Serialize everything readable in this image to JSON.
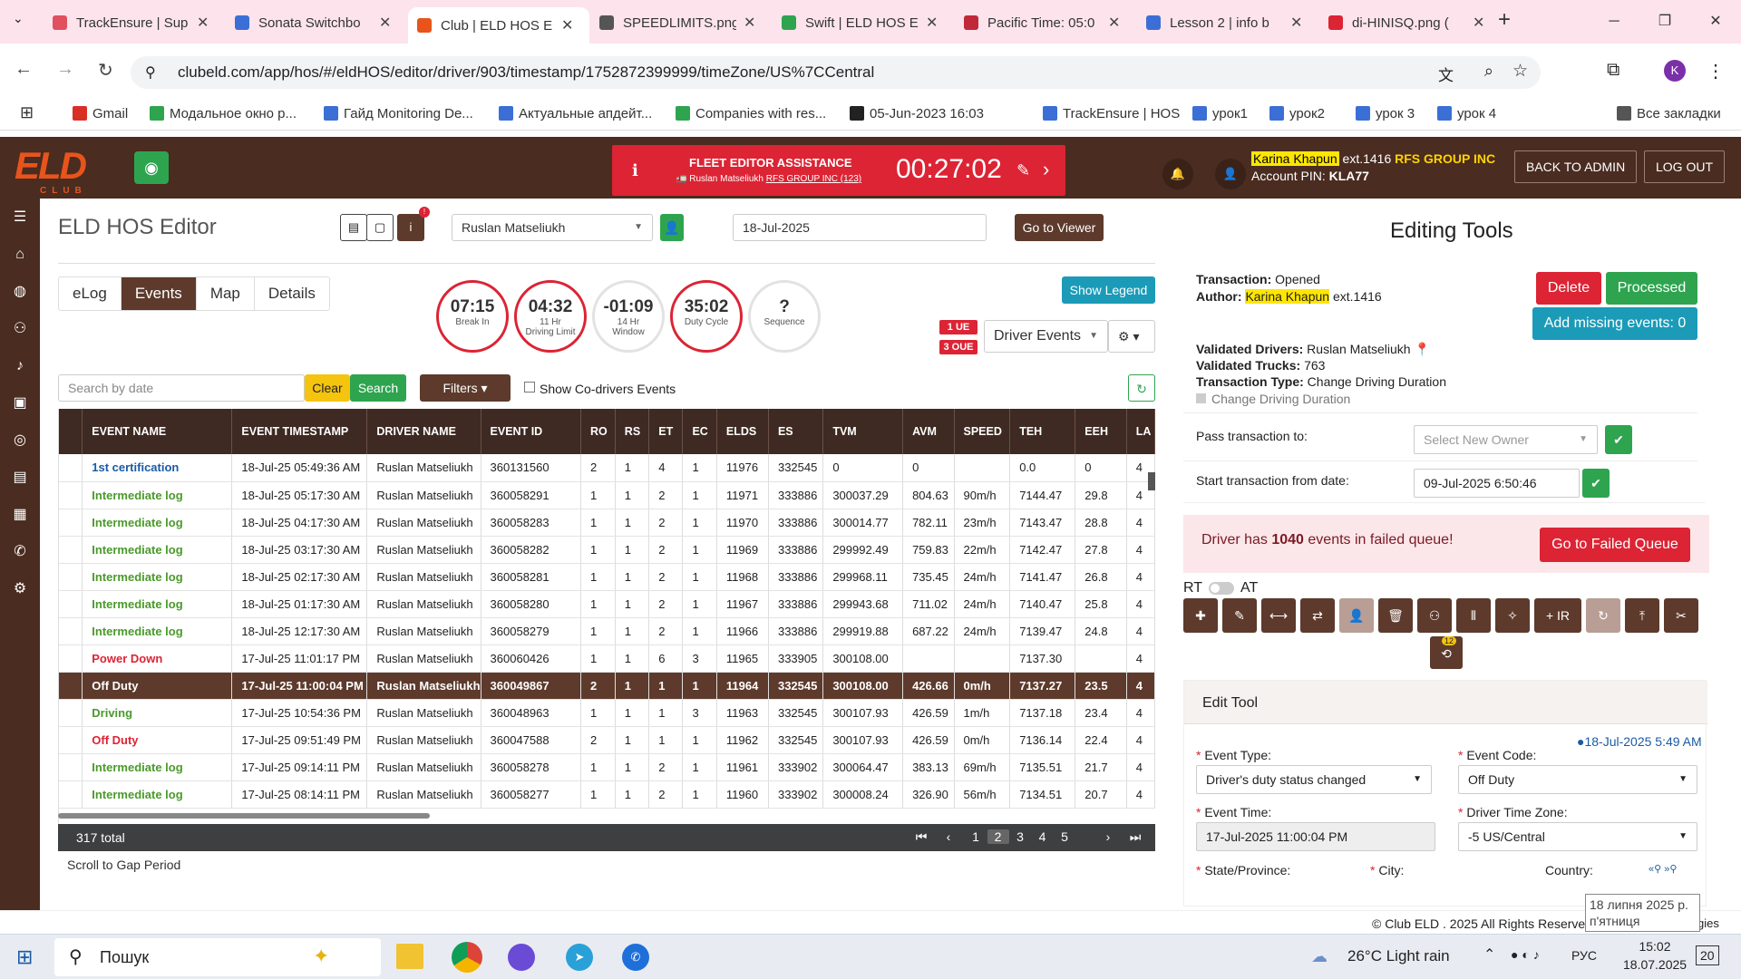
{
  "browser": {
    "tabs": [
      {
        "title": "TrackEnsure | Sup",
        "color": "#e0505e"
      },
      {
        "title": "Sonata Switchbo",
        "color": "#3b6fd6"
      },
      {
        "title": "Club | ELD HOS E",
        "color": "#e8541c"
      },
      {
        "title": "SPEEDLIMITS.png",
        "color": "#555555"
      },
      {
        "title": "Swift | ELD HOS E",
        "color": "#2ea44f"
      },
      {
        "title": "Pacific Time: 05:0",
        "color": "#c0293a"
      },
      {
        "title": "Lesson 2 | info b",
        "color": "#3b6fd6"
      },
      {
        "title": "di-HINISQ.png (",
        "color": "#dc2434"
      }
    ],
    "url": "clubeld.com/app/hos/#/eldHOS/editor/driver/903/timestamp/1752872399999/timeZone/US%7CCentral",
    "bookmarks": [
      "Gmail",
      "Модальное окно р...",
      "Гайд Monitoring De...",
      "Актуальные апдейт...",
      "Companies with res...",
      "05-Jun-2023 16:03",
      "TrackEnsure | HOS",
      "урок1",
      "урок2",
      "урок 3",
      "урок 4",
      "Все закладки"
    ]
  },
  "header": {
    "logo": "ELD",
    "logo_sub": "CLUB",
    "fleet_label": "FLEET EDITOR ASSISTANCE",
    "fleet_driver": "Ruslan Matseliukh",
    "fleet_company": "RFS GROUP INC (123)",
    "timer": "00:27:02",
    "user_name": "Karina Khapun",
    "user_ext": "ext.1416",
    "user_org": "RFS GROUP INC",
    "account_pin_label": "Account PIN:",
    "account_pin": "KLA77",
    "back_admin": "BACK TO ADMIN",
    "logout": "LOG OUT"
  },
  "editor": {
    "title": "ELD HOS Editor",
    "driver": "Ruslan Matseliukh",
    "date": "18-Jul-2025",
    "go_viewer": "Go to Viewer",
    "tabs": [
      "eLog",
      "Events",
      "Map",
      "Details"
    ],
    "show_legend": "Show Legend",
    "gauges": [
      {
        "value": "07:15",
        "l1": "Break In",
        "l2": ""
      },
      {
        "value": "04:32",
        "l1": "11 Hr",
        "l2": "Driving Limit"
      },
      {
        "value": "-01:09",
        "l1": "14 Hr",
        "l2": "Window"
      },
      {
        "value": "35:02",
        "l1": "Duty Cycle",
        "l2": ""
      },
      {
        "value": "?",
        "l1": "Sequence",
        "l2": ""
      }
    ],
    "badge_ue": "1 UE",
    "badge_oue": "3 OUE",
    "driver_events": "Driver Events",
    "search_placeholder": "Search by date",
    "clear": "Clear",
    "search": "Search",
    "filters": "Filters",
    "show_codrivers": "Show Co-drivers Events",
    "columns": [
      "EVENT NAME",
      "EVENT TIMESTAMP",
      "DRIVER NAME",
      "EVENT ID",
      "RO",
      "RS",
      "ET",
      "EC",
      "ELDS",
      "ES",
      "TVM",
      "AVM",
      "SPEED",
      "TEH",
      "EEH",
      "LA"
    ],
    "rows": [
      [
        "1st certification",
        "18-Jul-25 05:49:36 AM",
        "Ruslan Matseliukh",
        "360131560",
        "2",
        "1",
        "4",
        "1",
        "11976",
        "332545",
        "0",
        "0",
        "",
        "0.0",
        "0",
        "4"
      ],
      [
        "Intermediate log",
        "18-Jul-25 05:17:30 AM",
        "Ruslan Matseliukh",
        "360058291",
        "1",
        "1",
        "2",
        "1",
        "11971",
        "333886",
        "300037.29",
        "804.63",
        "90m/h",
        "7144.47",
        "29.8",
        "4"
      ],
      [
        "Intermediate log",
        "18-Jul-25 04:17:30 AM",
        "Ruslan Matseliukh",
        "360058283",
        "1",
        "1",
        "2",
        "1",
        "11970",
        "333886",
        "300014.77",
        "782.11",
        "23m/h",
        "7143.47",
        "28.8",
        "4"
      ],
      [
        "Intermediate log",
        "18-Jul-25 03:17:30 AM",
        "Ruslan Matseliukh",
        "360058282",
        "1",
        "1",
        "2",
        "1",
        "11969",
        "333886",
        "299992.49",
        "759.83",
        "22m/h",
        "7142.47",
        "27.8",
        "4"
      ],
      [
        "Intermediate log",
        "18-Jul-25 02:17:30 AM",
        "Ruslan Matseliukh",
        "360058281",
        "1",
        "1",
        "2",
        "1",
        "11968",
        "333886",
        "299968.11",
        "735.45",
        "24m/h",
        "7141.47",
        "26.8",
        "4"
      ],
      [
        "Intermediate log",
        "18-Jul-25 01:17:30 AM",
        "Ruslan Matseliukh",
        "360058280",
        "1",
        "1",
        "2",
        "1",
        "11967",
        "333886",
        "299943.68",
        "711.02",
        "24m/h",
        "7140.47",
        "25.8",
        "4"
      ],
      [
        "Intermediate log",
        "18-Jul-25 12:17:30 AM",
        "Ruslan Matseliukh",
        "360058279",
        "1",
        "1",
        "2",
        "1",
        "11966",
        "333886",
        "299919.88",
        "687.22",
        "24m/h",
        "7139.47",
        "24.8",
        "4"
      ],
      [
        "Power Down",
        "17-Jul-25 11:01:17 PM",
        "Ruslan Matseliukh",
        "360060426",
        "1",
        "1",
        "6",
        "3",
        "11965",
        "333905",
        "300108.00",
        "",
        "",
        "7137.30",
        "",
        "4"
      ],
      [
        "Off Duty",
        "17-Jul-25 11:00:04 PM",
        "Ruslan Matseliukh",
        "360049867",
        "2",
        "1",
        "1",
        "1",
        "11964",
        "332545",
        "300108.00",
        "426.66",
        "0m/h",
        "7137.27",
        "23.5",
        "4"
      ],
      [
        "Driving",
        "17-Jul-25 10:54:36 PM",
        "Ruslan Matseliukh",
        "360048963",
        "1",
        "1",
        "1",
        "3",
        "11963",
        "332545",
        "300107.93",
        "426.59",
        "1m/h",
        "7137.18",
        "23.4",
        "4"
      ],
      [
        "Off Duty",
        "17-Jul-25 09:51:49 PM",
        "Ruslan Matseliukh",
        "360047588",
        "2",
        "1",
        "1",
        "1",
        "11962",
        "332545",
        "300107.93",
        "426.59",
        "0m/h",
        "7136.14",
        "22.4",
        "4"
      ],
      [
        "Intermediate log",
        "17-Jul-25 09:14:11 PM",
        "Ruslan Matseliukh",
        "360058278",
        "1",
        "1",
        "2",
        "1",
        "11961",
        "333902",
        "300064.47",
        "383.13",
        "69m/h",
        "7135.51",
        "21.7",
        "4"
      ],
      [
        "Intermediate log",
        "17-Jul-25 08:14:11 PM",
        "Ruslan Matseliukh",
        "360058277",
        "1",
        "1",
        "2",
        "1",
        "11960",
        "333902",
        "300008.24",
        "326.90",
        "56m/h",
        "7134.51",
        "20.7",
        "4"
      ]
    ],
    "total": "317 total",
    "pages": [
      "1",
      "2",
      "3",
      "4",
      "5"
    ],
    "current_page": "2",
    "scroll_gap": "Scroll to Gap Period"
  },
  "tools": {
    "title": "Editing Tools",
    "transaction_label": "Transaction:",
    "transaction": "Opened",
    "author_label": "Author:",
    "author": "Karina Khapun",
    "author_ext": "ext.1416",
    "delete": "Delete",
    "processed": "Processed",
    "add_missing": "Add missing events: 0",
    "validated_drivers_label": "Validated Drivers:",
    "validated_drivers": "Ruslan Matseliukh",
    "validated_trucks_label": "Validated Trucks:",
    "validated_trucks": "763",
    "transaction_type_label": "Transaction Type:",
    "transaction_type": "Change Driving Duration",
    "change_driving": "Change Driving Duration",
    "pass_to": "Pass transaction to:",
    "owner_placeholder": "Select New Owner",
    "start_from": "Start transaction from date:",
    "start_date": "09-Jul-2025 6:50:46",
    "failed_pre": "Driver has",
    "failed_count": "1040",
    "failed_post": "events in failed queue!",
    "go_failed": "Go to Failed Queue",
    "rt": "RT",
    "at": "AT",
    "ir": "+ IR",
    "badge_12": "12",
    "edit_tool": "Edit Tool",
    "edit_date": "18-Jul-2025 5:49 AM",
    "event_type_label": "Event Type:",
    "event_type": "Driver's duty status changed",
    "event_code_label": "Event Code:",
    "event_code": "Off Duty",
    "event_time_label": "Event Time:",
    "event_time": "17-Jul-2025 11:00:04 PM",
    "tz_label": "Driver Time Zone:",
    "tz": "-5 US/Central",
    "state_label": "State/Province:",
    "city_label": "City:",
    "country_label": "Country:"
  },
  "footer": {
    "copyright": "© Club ELD . 2025 All Rights Reserve",
    "tail": "gies",
    "tooltip_l1": "18 липня 2025 р.",
    "tooltip_l2": "п'ятниця"
  },
  "taskbar": {
    "search": "Пошук",
    "weather": "26°C Light rain",
    "lang": "РУС",
    "time": "15:02",
    "date": "18.07.2025",
    "notif": "20"
  }
}
